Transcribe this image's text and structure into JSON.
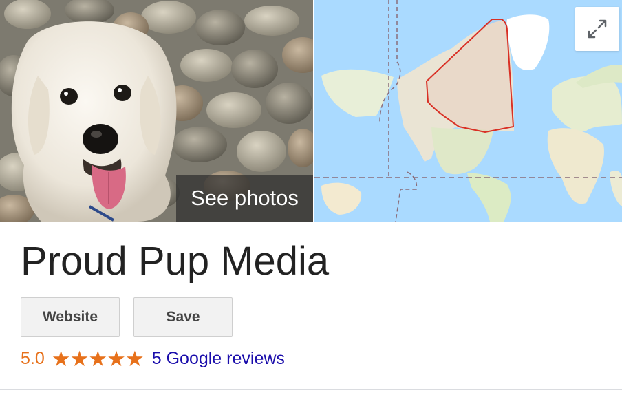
{
  "photos": {
    "see_photos_label": "See photos"
  },
  "map": {
    "expand_icon": "expand-arrows-icon"
  },
  "business": {
    "name": "Proud Pup Media"
  },
  "actions": {
    "website_label": "Website",
    "save_label": "Save"
  },
  "rating": {
    "value": "5.0",
    "stars": 5,
    "reviews_link": "5 Google reviews"
  },
  "colors": {
    "rating_orange": "#e7711b",
    "link_blue": "#1a0dab",
    "water": "#aadaff",
    "land": "#f2efe4",
    "region_outline": "#d93025"
  }
}
